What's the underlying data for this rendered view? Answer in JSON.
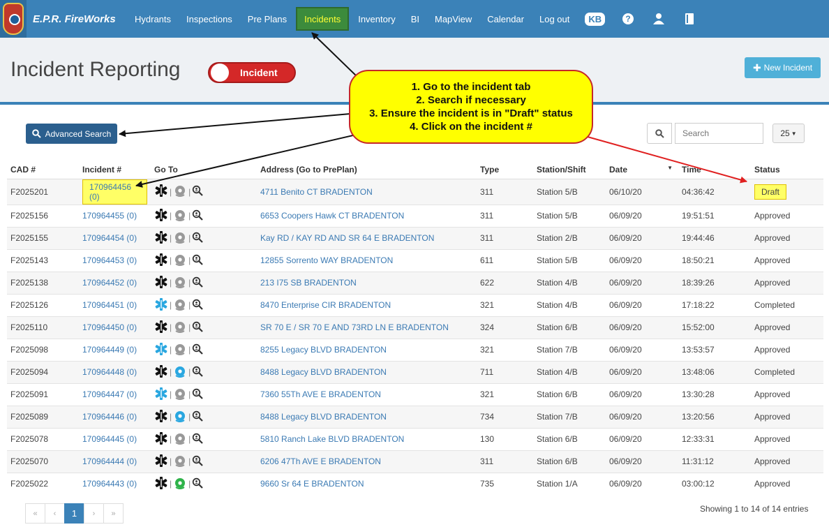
{
  "app": {
    "brand": "E.P.R. FireWorks"
  },
  "nav": {
    "items": [
      "Hydrants",
      "Inspections",
      "Pre Plans",
      "Incidents",
      "Inventory",
      "BI",
      "MapView",
      "Calendar",
      "Log out"
    ],
    "user_initials": "KB"
  },
  "page": {
    "title": "Incident Reporting",
    "toggle_label": "Incident",
    "new_button": "New Incident"
  },
  "toolbar": {
    "advanced_search": "Advanced Search",
    "search_placeholder": "Search",
    "page_size": "25"
  },
  "callout": {
    "lines": [
      "1. Go to the incident tab",
      "2. Search if necessary",
      "3. Ensure the incident is in \"Draft\" status",
      "4. Click on the incident #"
    ]
  },
  "colors": {
    "nav": "#3b82b8",
    "active_tab": "#3c8b3c",
    "highlight": "#ffff66",
    "callout": "#ffff00",
    "callout_border": "#c62828",
    "arrow_red": "#e02020",
    "icon_blue": "#2aa7e0",
    "icon_green": "#2fb34a",
    "icon_grey": "#999999"
  },
  "table": {
    "headers": [
      "CAD #",
      "Incident #",
      "Go To",
      "Address (Go to PrePlan)",
      "Type",
      "Station/Shift",
      "Date",
      "Time",
      "Status"
    ],
    "rows": [
      {
        "cad": "F2025201",
        "incident": "170964456 (0)",
        "ems": "black",
        "hydrant": "grey",
        "address": "4711 Benito CT BRADENTON",
        "type": "311",
        "station": "Station 5/B",
        "date": "06/10/20",
        "time": "04:36:42",
        "status": "Draft"
      },
      {
        "cad": "F2025156",
        "incident": "170964455 (0)",
        "ems": "black",
        "hydrant": "grey",
        "address": "6653 Coopers Hawk CT BRADENTON",
        "type": "311",
        "station": "Station 5/B",
        "date": "06/09/20",
        "time": "19:51:51",
        "status": "Approved"
      },
      {
        "cad": "F2025155",
        "incident": "170964454 (0)",
        "ems": "black",
        "hydrant": "grey",
        "address": "Kay RD / KAY RD AND SR 64 E BRADENTON",
        "type": "311",
        "station": "Station 2/B",
        "date": "06/09/20",
        "time": "19:44:46",
        "status": "Approved"
      },
      {
        "cad": "F2025143",
        "incident": "170964453 (0)",
        "ems": "black",
        "hydrant": "grey",
        "address": "12855 Sorrento WAY BRADENTON",
        "type": "611",
        "station": "Station 5/B",
        "date": "06/09/20",
        "time": "18:50:21",
        "status": "Approved"
      },
      {
        "cad": "F2025138",
        "incident": "170964452 (0)",
        "ems": "black",
        "hydrant": "grey",
        "address": "213 I75 SB BRADENTON",
        "type": "622",
        "station": "Station 4/B",
        "date": "06/09/20",
        "time": "18:39:26",
        "status": "Approved"
      },
      {
        "cad": "F2025126",
        "incident": "170964451 (0)",
        "ems": "blue",
        "hydrant": "grey",
        "address": "8470 Enterprise CIR BRADENTON",
        "type": "321",
        "station": "Station 4/B",
        "date": "06/09/20",
        "time": "17:18:22",
        "status": "Completed"
      },
      {
        "cad": "F2025110",
        "incident": "170964450 (0)",
        "ems": "black",
        "hydrant": "grey",
        "address": "SR 70 E / SR 70 E AND 73RD LN E BRADENTON",
        "type": "324",
        "station": "Station 6/B",
        "date": "06/09/20",
        "time": "15:52:00",
        "status": "Approved"
      },
      {
        "cad": "F2025098",
        "incident": "170964449 (0)",
        "ems": "blue",
        "hydrant": "grey",
        "address": "8255 Legacy BLVD BRADENTON",
        "type": "321",
        "station": "Station 7/B",
        "date": "06/09/20",
        "time": "13:53:57",
        "status": "Approved"
      },
      {
        "cad": "F2025094",
        "incident": "170964448 (0)",
        "ems": "black",
        "hydrant": "blue",
        "address": "8488 Legacy BLVD BRADENTON",
        "type": "711",
        "station": "Station 4/B",
        "date": "06/09/20",
        "time": "13:48:06",
        "status": "Completed"
      },
      {
        "cad": "F2025091",
        "incident": "170964447 (0)",
        "ems": "blue",
        "hydrant": "grey",
        "address": "7360 55Th AVE E BRADENTON",
        "type": "321",
        "station": "Station 6/B",
        "date": "06/09/20",
        "time": "13:30:28",
        "status": "Approved"
      },
      {
        "cad": "F2025089",
        "incident": "170964446 (0)",
        "ems": "black",
        "hydrant": "blue",
        "address": "8488 Legacy BLVD BRADENTON",
        "type": "734",
        "station": "Station 7/B",
        "date": "06/09/20",
        "time": "13:20:56",
        "status": "Approved"
      },
      {
        "cad": "F2025078",
        "incident": "170964445 (0)",
        "ems": "black",
        "hydrant": "grey",
        "address": "5810 Ranch Lake BLVD BRADENTON",
        "type": "130",
        "station": "Station 6/B",
        "date": "06/09/20",
        "time": "12:33:31",
        "status": "Approved"
      },
      {
        "cad": "F2025070",
        "incident": "170964444 (0)",
        "ems": "black",
        "hydrant": "grey",
        "address": "6206 47Th AVE E BRADENTON",
        "type": "311",
        "station": "Station 6/B",
        "date": "06/09/20",
        "time": "11:31:12",
        "status": "Approved"
      },
      {
        "cad": "F2025022",
        "incident": "170964443 (0)",
        "ems": "black",
        "hydrant": "green",
        "address": "9660 Sr 64 E BRADENTON",
        "type": "735",
        "station": "Station 1/A",
        "date": "06/09/20",
        "time": "03:00:12",
        "status": "Approved"
      }
    ]
  },
  "pagination": {
    "buttons": [
      "«",
      "‹",
      "1",
      "›",
      "»"
    ],
    "current": "1",
    "info": "Showing 1 to 14 of 14 entries"
  }
}
